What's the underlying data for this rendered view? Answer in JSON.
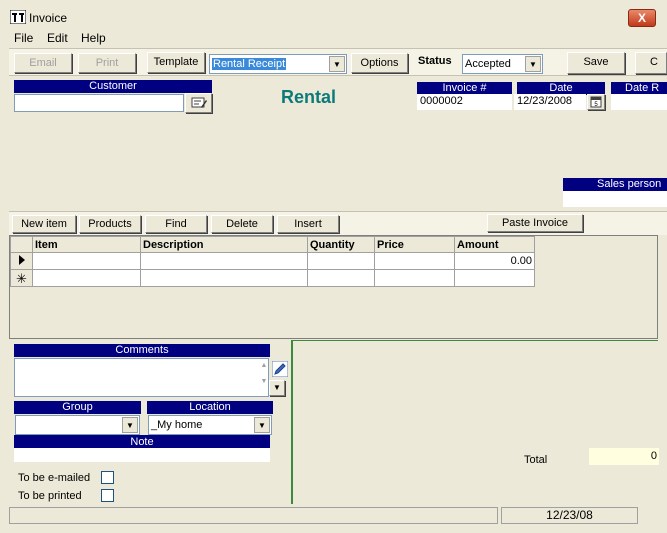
{
  "window": {
    "title": "Invoice",
    "close_label": "X"
  },
  "menu": {
    "file": "File",
    "edit": "Edit",
    "help": "Help"
  },
  "toolbar": {
    "email": "Email",
    "print": "Print",
    "template": "Template",
    "template_value": "Rental Receipt",
    "options": "Options",
    "status_label": "Status",
    "status_value": "Accepted",
    "save": "Save",
    "close_partial": "C"
  },
  "header": {
    "customer_label": "Customer",
    "customer_value": "",
    "doc_type": "Rental",
    "invoice_label": "Invoice #",
    "invoice_value": "0000002",
    "date_label": "Date",
    "date_value": "12/23/2008",
    "date_due_label": "Date R",
    "salesperson_label": "Sales person",
    "salesperson_value": ""
  },
  "grid_toolbar": {
    "new_item": "New item",
    "products": "Products",
    "find": "Find",
    "delete": "Delete",
    "insert": "Insert",
    "paste_invoice": "Paste Invoice"
  },
  "grid": {
    "columns": [
      "Item",
      "Description",
      "Quantity",
      "Price",
      "Amount"
    ],
    "rows": [
      {
        "item": "",
        "description": "",
        "quantity": "",
        "price": "",
        "amount": "0.00"
      }
    ]
  },
  "details": {
    "comments_label": "Comments",
    "comments_value": "",
    "group_label": "Group",
    "group_value": "",
    "location_label": "Location",
    "location_value": "_My home",
    "note_label": "Note",
    "to_be_emailed": "To be e-mailed",
    "to_be_printed": "To be printed"
  },
  "totals": {
    "total_label": "Total",
    "total_value": "0"
  },
  "statusbar": {
    "left": "",
    "date": "12/23/08"
  },
  "icons": {
    "app": "invoice-app-icon",
    "card": "card-icon",
    "calendar": "calendar-icon",
    "pencil": "pencil-icon",
    "row_pointer": "row-pointer-icon",
    "new_row": "new-row-icon"
  }
}
